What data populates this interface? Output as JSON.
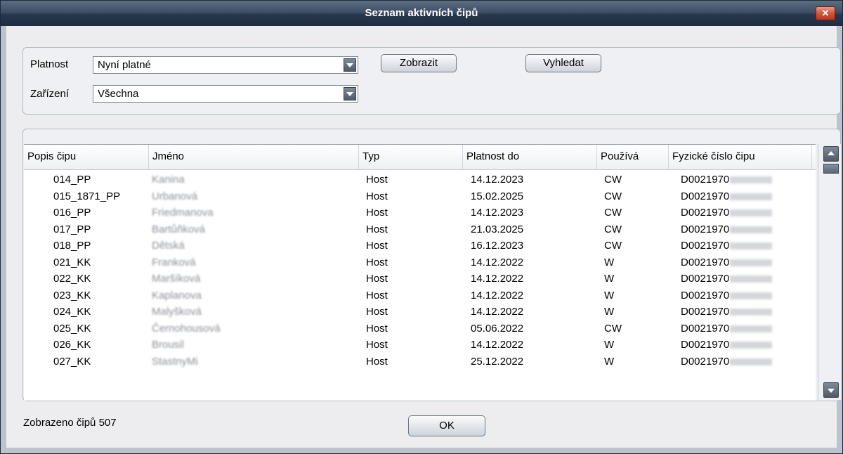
{
  "window": {
    "title": "Seznam aktivních čipů",
    "close_label": "✕"
  },
  "filters": {
    "platnost_label": "Platnost",
    "platnost_value": "Nyní platné",
    "zarizeni_label": "Zařízení",
    "zarizeni_value": "Všechna",
    "show_button": "Zobrazit",
    "search_button": "Vyhledat"
  },
  "table": {
    "columns": [
      "Popis čipu",
      "Jméno",
      "Typ",
      "Platnost do",
      "Používá",
      "Fyzické číslo čipu"
    ],
    "rows": [
      {
        "popis": "014_PP",
        "jmeno": "Kanina",
        "typ": "Host",
        "platnost": "14.12.2023",
        "pouziva": "CW",
        "fyz": "D0021970"
      },
      {
        "popis": "015_1871_PP",
        "jmeno": "Urbanová",
        "typ": "Host",
        "platnost": "15.02.2025",
        "pouziva": "CW",
        "fyz": "D0021970"
      },
      {
        "popis": "016_PP",
        "jmeno": "Friedmanova",
        "typ": "Host",
        "platnost": "14.12.2023",
        "pouziva": "CW",
        "fyz": "D0021970"
      },
      {
        "popis": "017_PP",
        "jmeno": "Bartůňková",
        "typ": "Host",
        "platnost": "21.03.2025",
        "pouziva": "CW",
        "fyz": "D0021970"
      },
      {
        "popis": "018_PP",
        "jmeno": "Dětská",
        "typ": "Host",
        "platnost": "16.12.2023",
        "pouziva": "CW",
        "fyz": "D0021970"
      },
      {
        "popis": "021_KK",
        "jmeno": "Franková",
        "typ": "Host",
        "platnost": "14.12.2022",
        "pouziva": "W",
        "fyz": "D0021970"
      },
      {
        "popis": "022_KK",
        "jmeno": "Maršíková",
        "typ": "Host",
        "platnost": "14.12.2022",
        "pouziva": "W",
        "fyz": "D0021970"
      },
      {
        "popis": "023_KK",
        "jmeno": "Kaplanova",
        "typ": "Host",
        "platnost": "14.12.2022",
        "pouziva": "W",
        "fyz": "D0021970"
      },
      {
        "popis": "024_KK",
        "jmeno": "Malyšková",
        "typ": "Host",
        "platnost": "14.12.2022",
        "pouziva": "W",
        "fyz": "D0021970"
      },
      {
        "popis": "025_KK",
        "jmeno": "Černohousová",
        "typ": "Host",
        "platnost": "05.06.2022",
        "pouziva": "CW",
        "fyz": "D0021970"
      },
      {
        "popis": "026_KK",
        "jmeno": "Brousil",
        "typ": "Host",
        "platnost": "14.12.2022",
        "pouziva": "W",
        "fyz": "D0021970"
      },
      {
        "popis": "027_KK",
        "jmeno": "StastnyMi",
        "typ": "Host",
        "platnost": "25.12.2022",
        "pouziva": "W",
        "fyz": "D0021970"
      }
    ]
  },
  "status": {
    "text": "Zobrazeno čipů  507"
  },
  "footer": {
    "ok_button": "OK"
  }
}
